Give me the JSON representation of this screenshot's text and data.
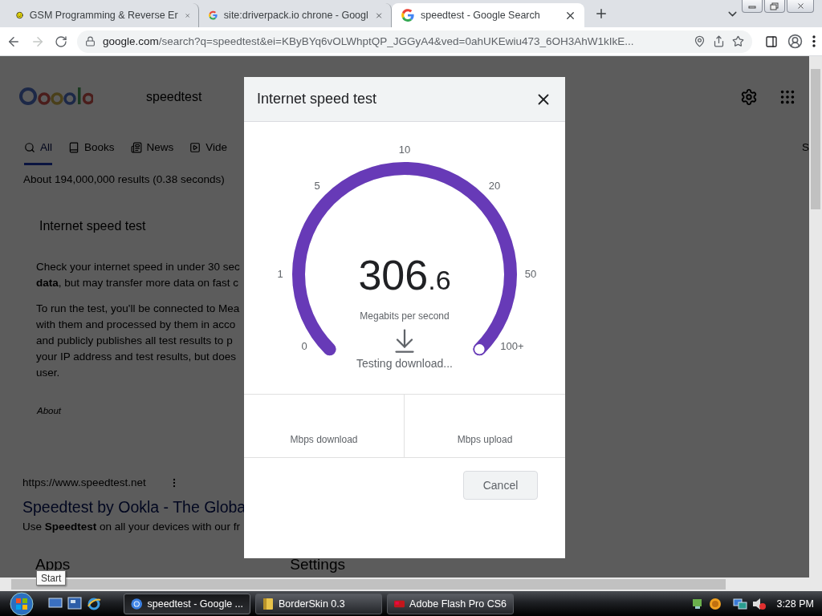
{
  "browser": {
    "tabs": [
      {
        "title": "GSM Programming & Reverse Er",
        "selected": false
      },
      {
        "title": "site:driverpack.io chrone - Googl",
        "selected": false
      },
      {
        "title": "speedtest - Google Search",
        "selected": true
      }
    ],
    "address": {
      "host": "google.com",
      "path": "/search?q=speedtest&ei=KByBYq6vOLWhptQP_JGGyA4&ved=0ahUKEwiu473_6OH3AhW1kIkE..."
    },
    "forward_disabled": true
  },
  "page": {
    "query": "speedtest",
    "nav": [
      {
        "label": "All",
        "selected": true
      },
      {
        "label": "Books",
        "selected": false
      },
      {
        "label": "News",
        "selected": false
      },
      {
        "label": "Vide",
        "selected": false
      }
    ],
    "nav_edge": "S",
    "result_stats": "About 194,000,000 results (0.38 seconds)",
    "card": {
      "title": "Internet speed test",
      "paragraphs": [
        [
          "Check your internet speed in under 30 sec",
          "**data**, but may transfer more data on fast c"
        ],
        [
          "To run the test, you'll be connected to Mea",
          "with them and processed by them in acco",
          "and publicly publishes all test results to p",
          "your IP address and test results, but does",
          "user."
        ]
      ],
      "about": "About"
    },
    "result": {
      "url": "https://www.speedtest.net",
      "title": "Speedtest by Ookla - The Globa",
      "snippet": "Use **Speedtest** on all your devices with our fr"
    },
    "sections": [
      "Apps",
      "Settings"
    ]
  },
  "dialog": {
    "title": "Internet speed test",
    "gauge": {
      "ticks": [
        "0",
        "1",
        "5",
        "10",
        "20",
        "50",
        "100+"
      ],
      "level": 1,
      "whole": "306",
      "fraction": ".6",
      "unit": "Megabits per second",
      "status": "Testing download..."
    },
    "results": [
      {
        "label": "Mbps download"
      },
      {
        "label": "Mbps upload"
      }
    ],
    "cancel": "Cancel"
  },
  "tooltip": "Start",
  "taskbar": {
    "tasks": [
      {
        "label": "speedtest - Google ...",
        "selected": true
      },
      {
        "label": "BorderSkin 0.3",
        "selected": false
      },
      {
        "label": "Adobe Flash Pro CS6",
        "selected": false
      }
    ],
    "clock": "3:28 PM"
  }
}
